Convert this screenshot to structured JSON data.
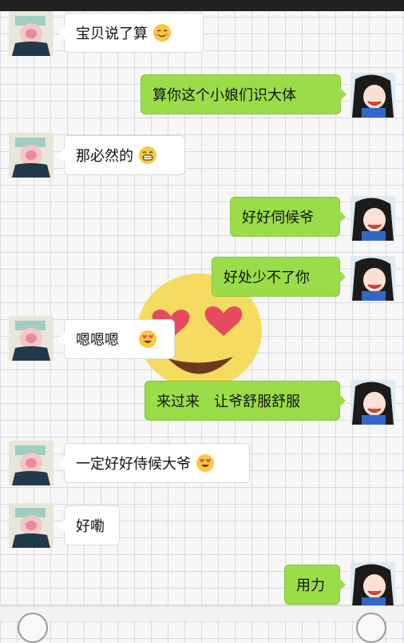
{
  "colors": {
    "sent_bubble": "#9bdd48",
    "received_bubble": "#ffffff",
    "grid_line": "#d9d9e2"
  },
  "messages": [
    {
      "side": "left",
      "text": "宝贝说了算",
      "emoji": "smiling-face-icon"
    },
    {
      "side": "right",
      "text": "算你这个小娘们识大体"
    },
    {
      "side": "left",
      "text": "那必然的",
      "emoji": "grinning-face-icon"
    },
    {
      "side": "right",
      "text": "好好伺候爷"
    },
    {
      "side": "right",
      "text": "好处少不了你"
    },
    {
      "side": "left",
      "text": "嗯嗯嗯",
      "emoji": "heart-eyes-icon"
    },
    {
      "side": "right",
      "text": "来过来",
      "text2": "让爷舒服舒服"
    },
    {
      "side": "left",
      "text": "一定好好侍候大爷",
      "emoji": "heart-eyes-icon"
    },
    {
      "side": "left",
      "text": "好嘞"
    },
    {
      "side": "right",
      "text": "用力"
    }
  ]
}
